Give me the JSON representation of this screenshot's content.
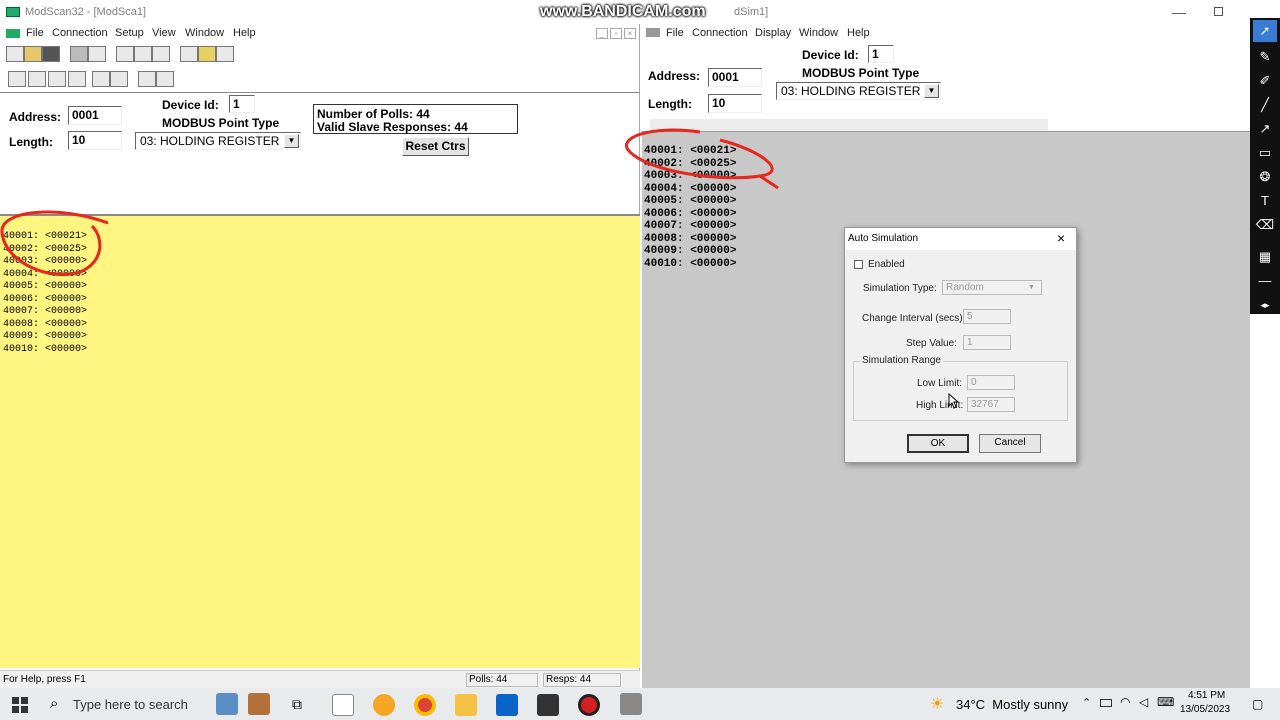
{
  "watermark": "www.BANDICAM.com",
  "left": {
    "title": "ModScan32 - [ModSca1]",
    "menu": [
      "File",
      "Connection",
      "Setup",
      "View",
      "Window",
      "Help"
    ],
    "address_label": "Address:",
    "address_value": "0001",
    "length_label": "Length:",
    "length_value": "10",
    "device_label": "Device Id:",
    "device_value": "1",
    "point_type_label": "MODBUS Point Type",
    "point_type_value": "03: HOLDING REGISTER",
    "polls_line": "Number of Polls: 44",
    "responses_line": "Valid Slave Responses: 44",
    "reset_label": "Reset Ctrs",
    "registers": [
      "40001: <00021>",
      "40002: <00025>",
      "40003: <00000>",
      "40004: <00000>",
      "40005: <00000>",
      "40006: <00000>",
      "40007: <00000>",
      "40008: <00000>",
      "40009: <00000>",
      "40010: <00000>"
    ],
    "status_help": "For Help, press F1",
    "status_polls": "Polls: 44",
    "status_resps": "Resps: 44"
  },
  "right": {
    "title_visible": "dSim1]",
    "menu": [
      "File",
      "Connection",
      "Display",
      "Window",
      "Help"
    ],
    "address_label": "Address:",
    "address_value": "0001",
    "length_label": "Length:",
    "length_value": "10",
    "device_label": "Device Id:",
    "device_value": "1",
    "point_type_label": "MODBUS Point Type",
    "point_type_value": "03: HOLDING REGISTER",
    "registers": [
      "40001: <00021>",
      "40002: <00025>",
      "40003: <00000>",
      "40004: <00000>",
      "40005: <00000>",
      "40006: <00000>",
      "40007: <00000>",
      "40008: <00000>",
      "40009: <00000>",
      "40010: <00000>"
    ]
  },
  "dialog": {
    "title": "Auto Simulation",
    "enabled_label": "Enabled",
    "sim_type_label": "Simulation Type:",
    "sim_type_value": "Random",
    "interval_label": "Change Interval (secs):",
    "interval_value": "5",
    "step_label": "Step Value:",
    "step_value": "1",
    "range_label": "Simulation Range",
    "low_label": "Low Limit:",
    "low_value": "0",
    "high_label": "High Limit:",
    "high_value": "32767",
    "ok_label": "OK",
    "cancel_label": "Cancel"
  },
  "taskbar": {
    "search_placeholder": "Type here to search",
    "weather": "34°C  Mostly sunny",
    "time": "4:51 PM",
    "date": "13/05/2023"
  },
  "colors": {
    "data_area_left": "#fff580",
    "data_area_right": "#c8c8c8",
    "annotation": "#e8261c"
  }
}
